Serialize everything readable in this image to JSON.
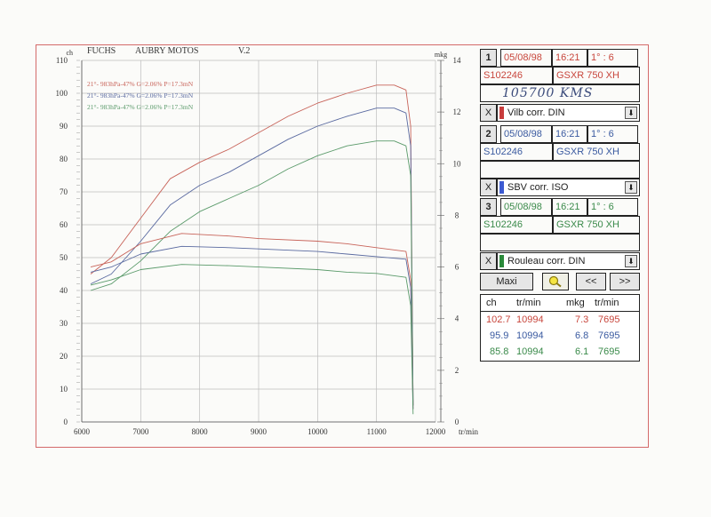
{
  "header": {
    "brand": "FUCHS",
    "shop": "AUBRY MOTOS",
    "version": "V.2",
    "left_unit": "ch",
    "right_unit": "mkg",
    "x_unit": "tr/min"
  },
  "chart_data": {
    "type": "line",
    "x_label": "tr/min",
    "y_left_label": "ch",
    "y_right_label": "mkg",
    "xlim": [
      6000,
      12000
    ],
    "ylim_left": [
      0,
      110
    ],
    "ylim_right": [
      0,
      14
    ],
    "x_ticks": [
      6000,
      7000,
      8000,
      9000,
      10000,
      11000,
      12000
    ],
    "y_left_ticks": [
      0,
      10,
      20,
      30,
      40,
      50,
      60,
      70,
      80,
      90,
      100,
      110
    ],
    "y_right_ticks": [
      0,
      2,
      4,
      6,
      8,
      10,
      12,
      14
    ],
    "grid": true,
    "legend_position": "top-left",
    "annotations": [
      {
        "text": "21°- 983hPa-47% G=2.06% P=17.3mN",
        "color": "#c8645a"
      },
      {
        "text": "21°- 983hPa-47% G=2.06% P=17.3mN",
        "color": "#5a6aa0"
      },
      {
        "text": "21°- 983hPa-47% G=2.06% P=17.3mN",
        "color": "#5a9a6a"
      }
    ],
    "series": [
      {
        "kind": "power",
        "axis": "left",
        "color": "#c8645a",
        "x": [
          6150,
          6500,
          7000,
          7500,
          8000,
          8500,
          9000,
          9500,
          10000,
          10500,
          11000,
          11300,
          11500,
          11580,
          11620
        ],
        "y": [
          45,
          50,
          62,
          74,
          79,
          83,
          88,
          93,
          97,
          100,
          102.5,
          102.5,
          101,
          90,
          5
        ]
      },
      {
        "kind": "power",
        "axis": "left",
        "color": "#5a6aa0",
        "x": [
          6150,
          6500,
          7000,
          7500,
          8000,
          8500,
          9000,
          9500,
          10000,
          10500,
          11000,
          11300,
          11500,
          11580,
          11620
        ],
        "y": [
          42,
          45,
          55,
          66,
          72,
          76,
          81,
          86,
          90,
          93,
          95.5,
          95.5,
          94,
          84,
          5
        ]
      },
      {
        "kind": "power",
        "axis": "left",
        "color": "#5a9a6a",
        "x": [
          6150,
          6500,
          7000,
          7500,
          8000,
          8500,
          9000,
          9500,
          10000,
          10500,
          11000,
          11300,
          11500,
          11580,
          11620
        ],
        "y": [
          40,
          42,
          49,
          58,
          64,
          68,
          72,
          77,
          81,
          84,
          85.5,
          85.5,
          84,
          75,
          5
        ]
      },
      {
        "kind": "torque",
        "axis": "right",
        "color": "#c8645a",
        "x": [
          6150,
          6500,
          7000,
          7695,
          8500,
          9000,
          10000,
          10500,
          11000,
          11500,
          11580,
          11620
        ],
        "y": [
          6.0,
          6.2,
          6.9,
          7.3,
          7.2,
          7.1,
          7.0,
          6.9,
          6.75,
          6.6,
          5.5,
          0.5
        ]
      },
      {
        "kind": "torque",
        "axis": "right",
        "color": "#5a6aa0",
        "x": [
          6150,
          6500,
          7000,
          7695,
          8500,
          9000,
          10000,
          10500,
          11000,
          11500,
          11580,
          11620
        ],
        "y": [
          5.8,
          6.0,
          6.5,
          6.8,
          6.75,
          6.7,
          6.6,
          6.5,
          6.4,
          6.3,
          5.2,
          0.5
        ]
      },
      {
        "kind": "torque",
        "axis": "right",
        "color": "#5a9a6a",
        "x": [
          6150,
          6500,
          7000,
          7695,
          8500,
          9000,
          10000,
          10500,
          11000,
          11500,
          11580,
          11620
        ],
        "y": [
          5.3,
          5.5,
          5.9,
          6.1,
          6.05,
          6.0,
          5.9,
          5.8,
          5.75,
          5.6,
          4.5,
          0.3
        ]
      }
    ]
  },
  "runs": [
    {
      "num": "1",
      "date": "05/08/98",
      "time": "16:21",
      "ratio": "1° : 6",
      "serial": "S102246",
      "model": "GSXR 750 XH",
      "note": "105700 KMS",
      "correction": "Vilb corr. DIN",
      "color": "#c8463c",
      "swatch": "#c83c3c"
    },
    {
      "num": "2",
      "date": "05/08/98",
      "time": "16:21",
      "ratio": "1° : 6",
      "serial": "S102246",
      "model": "GSXR 750 XH",
      "note": "",
      "correction": "SBV corr. ISO",
      "color": "#3a5aa0",
      "swatch": "#3c5ad2"
    },
    {
      "num": "3",
      "date": "05/08/98",
      "time": "16:21",
      "ratio": "1° : 6",
      "serial": "S102246",
      "model": "GSXR 750 XH",
      "note": "",
      "correction": "Rouleau corr. DIN",
      "color": "#3a8a4a",
      "swatch": "#2a8a3a"
    }
  ],
  "close_glyph": "X",
  "dropdown_glyph": "⬇",
  "buttons": {
    "maxi": "Maxi",
    "prev": "<<",
    "next": ">>"
  },
  "results": {
    "headers": {
      "ch": "ch",
      "rpm1": "tr/min",
      "mkg": "mkg",
      "rpm2": "tr/min"
    },
    "rows": [
      {
        "ch": "102.7",
        "rpm1": "10994",
        "mkg": "7.3",
        "rpm2": "7695",
        "color": "#c8463c"
      },
      {
        "ch": "95.9",
        "rpm1": "10994",
        "mkg": "6.8",
        "rpm2": "7695",
        "color": "#3a5aa0"
      },
      {
        "ch": "85.8",
        "rpm1": "10994",
        "mkg": "6.1",
        "rpm2": "7695",
        "color": "#3a8a4a"
      }
    ]
  }
}
